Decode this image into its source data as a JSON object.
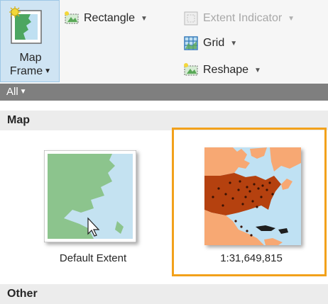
{
  "ribbon": {
    "map_frame": {
      "label_line1": "Map",
      "label_line2": "Frame"
    },
    "rectangle": {
      "label": "Rectangle"
    },
    "extent_indicator": {
      "label": "Extent Indicator"
    },
    "grid": {
      "label": "Grid"
    },
    "reshape": {
      "label": "Reshape"
    }
  },
  "gallery": {
    "filter": {
      "label": "All"
    },
    "sections": [
      {
        "title": "Map",
        "items": [
          {
            "caption": "Default Extent"
          },
          {
            "caption": "1:31,649,815"
          }
        ]
      },
      {
        "title": "Other"
      }
    ]
  },
  "colors": {
    "selection_highlight": "#f2a11b",
    "filter_bar": "#7f7f7f",
    "map_frame_button_bg": "#cfe4f3"
  }
}
